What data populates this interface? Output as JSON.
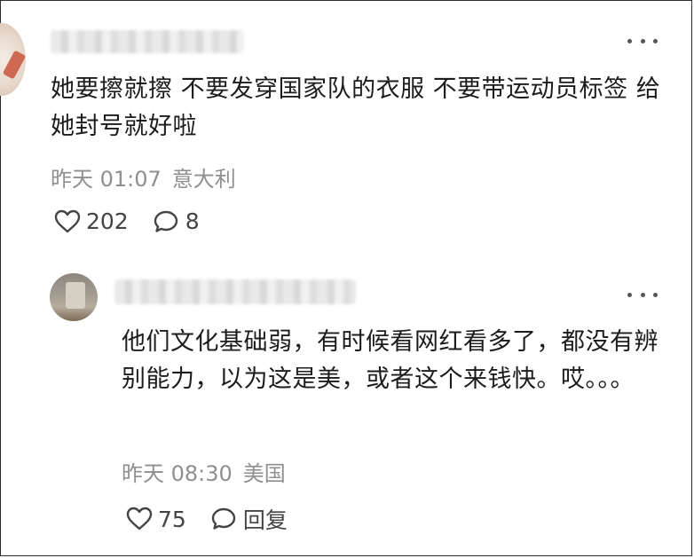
{
  "comments": [
    {
      "text": "她要擦就擦 不要发穿国家队的衣服 不要带运动员标签 给她封号就好啦",
      "time": "昨天 01:07",
      "location": "意大利",
      "likes": "202",
      "replies": "8"
    }
  ],
  "reply": {
    "text": "他们文化基础弱，有时候看网红看多了，都没有辨别能力，以为这是美，或者这个来钱快。哎。。。",
    "time": "昨天 08:30",
    "location": "美国",
    "likes": "75",
    "reply_label": "回复"
  },
  "icons": {
    "more": "more-dots-icon",
    "like": "heart-outline-icon",
    "comment": "speech-bubble-icon"
  },
  "colors": {
    "text": "#1c1c1c",
    "meta": "#8f8f8f",
    "icon": "#444444"
  }
}
